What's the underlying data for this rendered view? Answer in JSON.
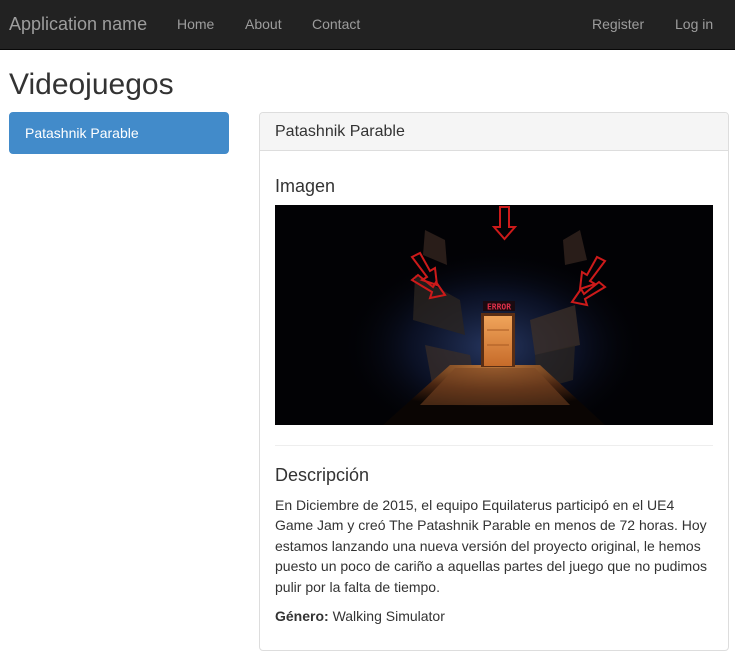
{
  "navbar": {
    "brand": "Application name",
    "links": {
      "home": "Home",
      "about": "About",
      "contact": "Contact",
      "register": "Register",
      "login": "Log in"
    }
  },
  "page": {
    "title": "Videojuegos"
  },
  "sidebar": {
    "items": [
      {
        "label": "Patashnik Parable",
        "active": true
      }
    ]
  },
  "panel": {
    "heading": "Patashnik Parable",
    "image_heading": "Imagen",
    "image_sign_text": "ERROR",
    "description_heading": "Descripción",
    "description": "En Diciembre de 2015, el equipo Equilaterus participó en el UE4 Game Jam y creó The Patashnik Parable en menos de 72 horas. Hoy estamos lanzando una nueva versión del proyecto original, le hemos puesto un poco de cariño a aquellas partes del juego que no pudimos pulir por la falta de tiempo.",
    "genre_label": "Género:",
    "genre_value": "Walking Simulator"
  },
  "colors": {
    "navbar_bg": "#222222",
    "navbar_text": "#9d9d9d",
    "active_item_bg": "#428bca",
    "panel_border": "#dddddd",
    "panel_heading_bg": "#f5f5f5",
    "arrow_red": "#cc1a1a",
    "door_orange": "#d9863a"
  }
}
